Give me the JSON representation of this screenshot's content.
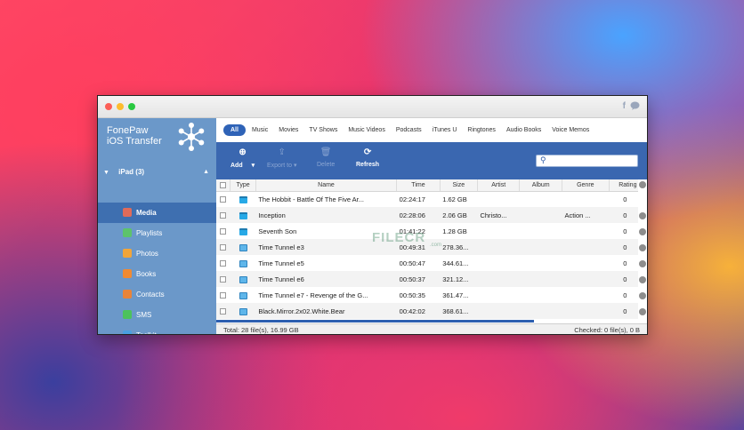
{
  "app": {
    "brand_line1": "FonePaw",
    "brand_line2": "iOS Transfer"
  },
  "titlebar": {
    "facebook_icon": "f",
    "chat_icon": "chat"
  },
  "device": {
    "label": "iPad (3)"
  },
  "sidebar": {
    "items": [
      {
        "label": "Media",
        "icon": "media-icon",
        "color": "#e06b5a"
      },
      {
        "label": "Playlists",
        "icon": "playlists-icon",
        "color": "#5dc36b"
      },
      {
        "label": "Photos",
        "icon": "photos-icon",
        "color": "#f2a53a"
      },
      {
        "label": "Books",
        "icon": "books-icon",
        "color": "#f08a32"
      },
      {
        "label": "Contacts",
        "icon": "contacts-icon",
        "color": "#e8843a"
      },
      {
        "label": "SMS",
        "icon": "sms-icon",
        "color": "#4cc25d"
      },
      {
        "label": "Toolkit",
        "icon": "toolkit-icon",
        "color": "#4aa0e0"
      }
    ]
  },
  "filters": [
    "All",
    "Music",
    "Movies",
    "TV Shows",
    "Music Videos",
    "Podcasts",
    "iTunes U",
    "Ringtones",
    "Audio Books",
    "Voice Memos"
  ],
  "toolbar": {
    "add": "Add",
    "export": "Export to",
    "delete": "Delete",
    "refresh": "Refresh",
    "search_placeholder": ""
  },
  "table": {
    "columns": [
      "Type",
      "Name",
      "Time",
      "Size",
      "Artist",
      "Album",
      "Genre",
      "Rating"
    ],
    "rows": [
      {
        "type": "movie",
        "name": "The Hobbit - Battle Of The Five Ar...",
        "time": "02:24:17",
        "size": "1.62 GB",
        "artist": "",
        "album": "",
        "genre": "",
        "rating": "0"
      },
      {
        "type": "movie",
        "name": "Inception",
        "time": "02:28:06",
        "size": "2.06 GB",
        "artist": "Christo...",
        "album": "",
        "genre": "Action ...",
        "rating": "0"
      },
      {
        "type": "movie",
        "name": "Seventh Son",
        "time": "01:41:22",
        "size": "1.28 GB",
        "artist": "",
        "album": "",
        "genre": "",
        "rating": "0"
      },
      {
        "type": "tv",
        "name": "Time Tunnel e3",
        "time": "00:49:31",
        "size": "278.36...",
        "artist": "",
        "album": "",
        "genre": "",
        "rating": "0"
      },
      {
        "type": "tv",
        "name": "Time Tunnel e5",
        "time": "00:50:47",
        "size": "344.61...",
        "artist": "",
        "album": "",
        "genre": "",
        "rating": "0"
      },
      {
        "type": "tv",
        "name": "Time Tunnel e6",
        "time": "00:50:37",
        "size": "321.12...",
        "artist": "",
        "album": "",
        "genre": "",
        "rating": "0"
      },
      {
        "type": "tv",
        "name": "Time Tunnel e7 - Revenge of the G...",
        "time": "00:50:35",
        "size": "361.47...",
        "artist": "",
        "album": "",
        "genre": "",
        "rating": "0"
      },
      {
        "type": "tv",
        "name": "Black.Mirror.2x02.White.Bear",
        "time": "00:42:02",
        "size": "368.61...",
        "artist": "",
        "album": "",
        "genre": "",
        "rating": "0"
      }
    ]
  },
  "status": {
    "total": "Total: 28 file(s), 16.99 GB",
    "checked": "Checked: 0 file(s), 0 B"
  },
  "watermark": {
    "text": "FILECR",
    "sub": ".com"
  },
  "colors": {
    "accent": "#2f63b7",
    "toolbar": "#3a67b0",
    "sidebar": "#6b98c9",
    "sidebar_active": "#3e6fb0"
  }
}
